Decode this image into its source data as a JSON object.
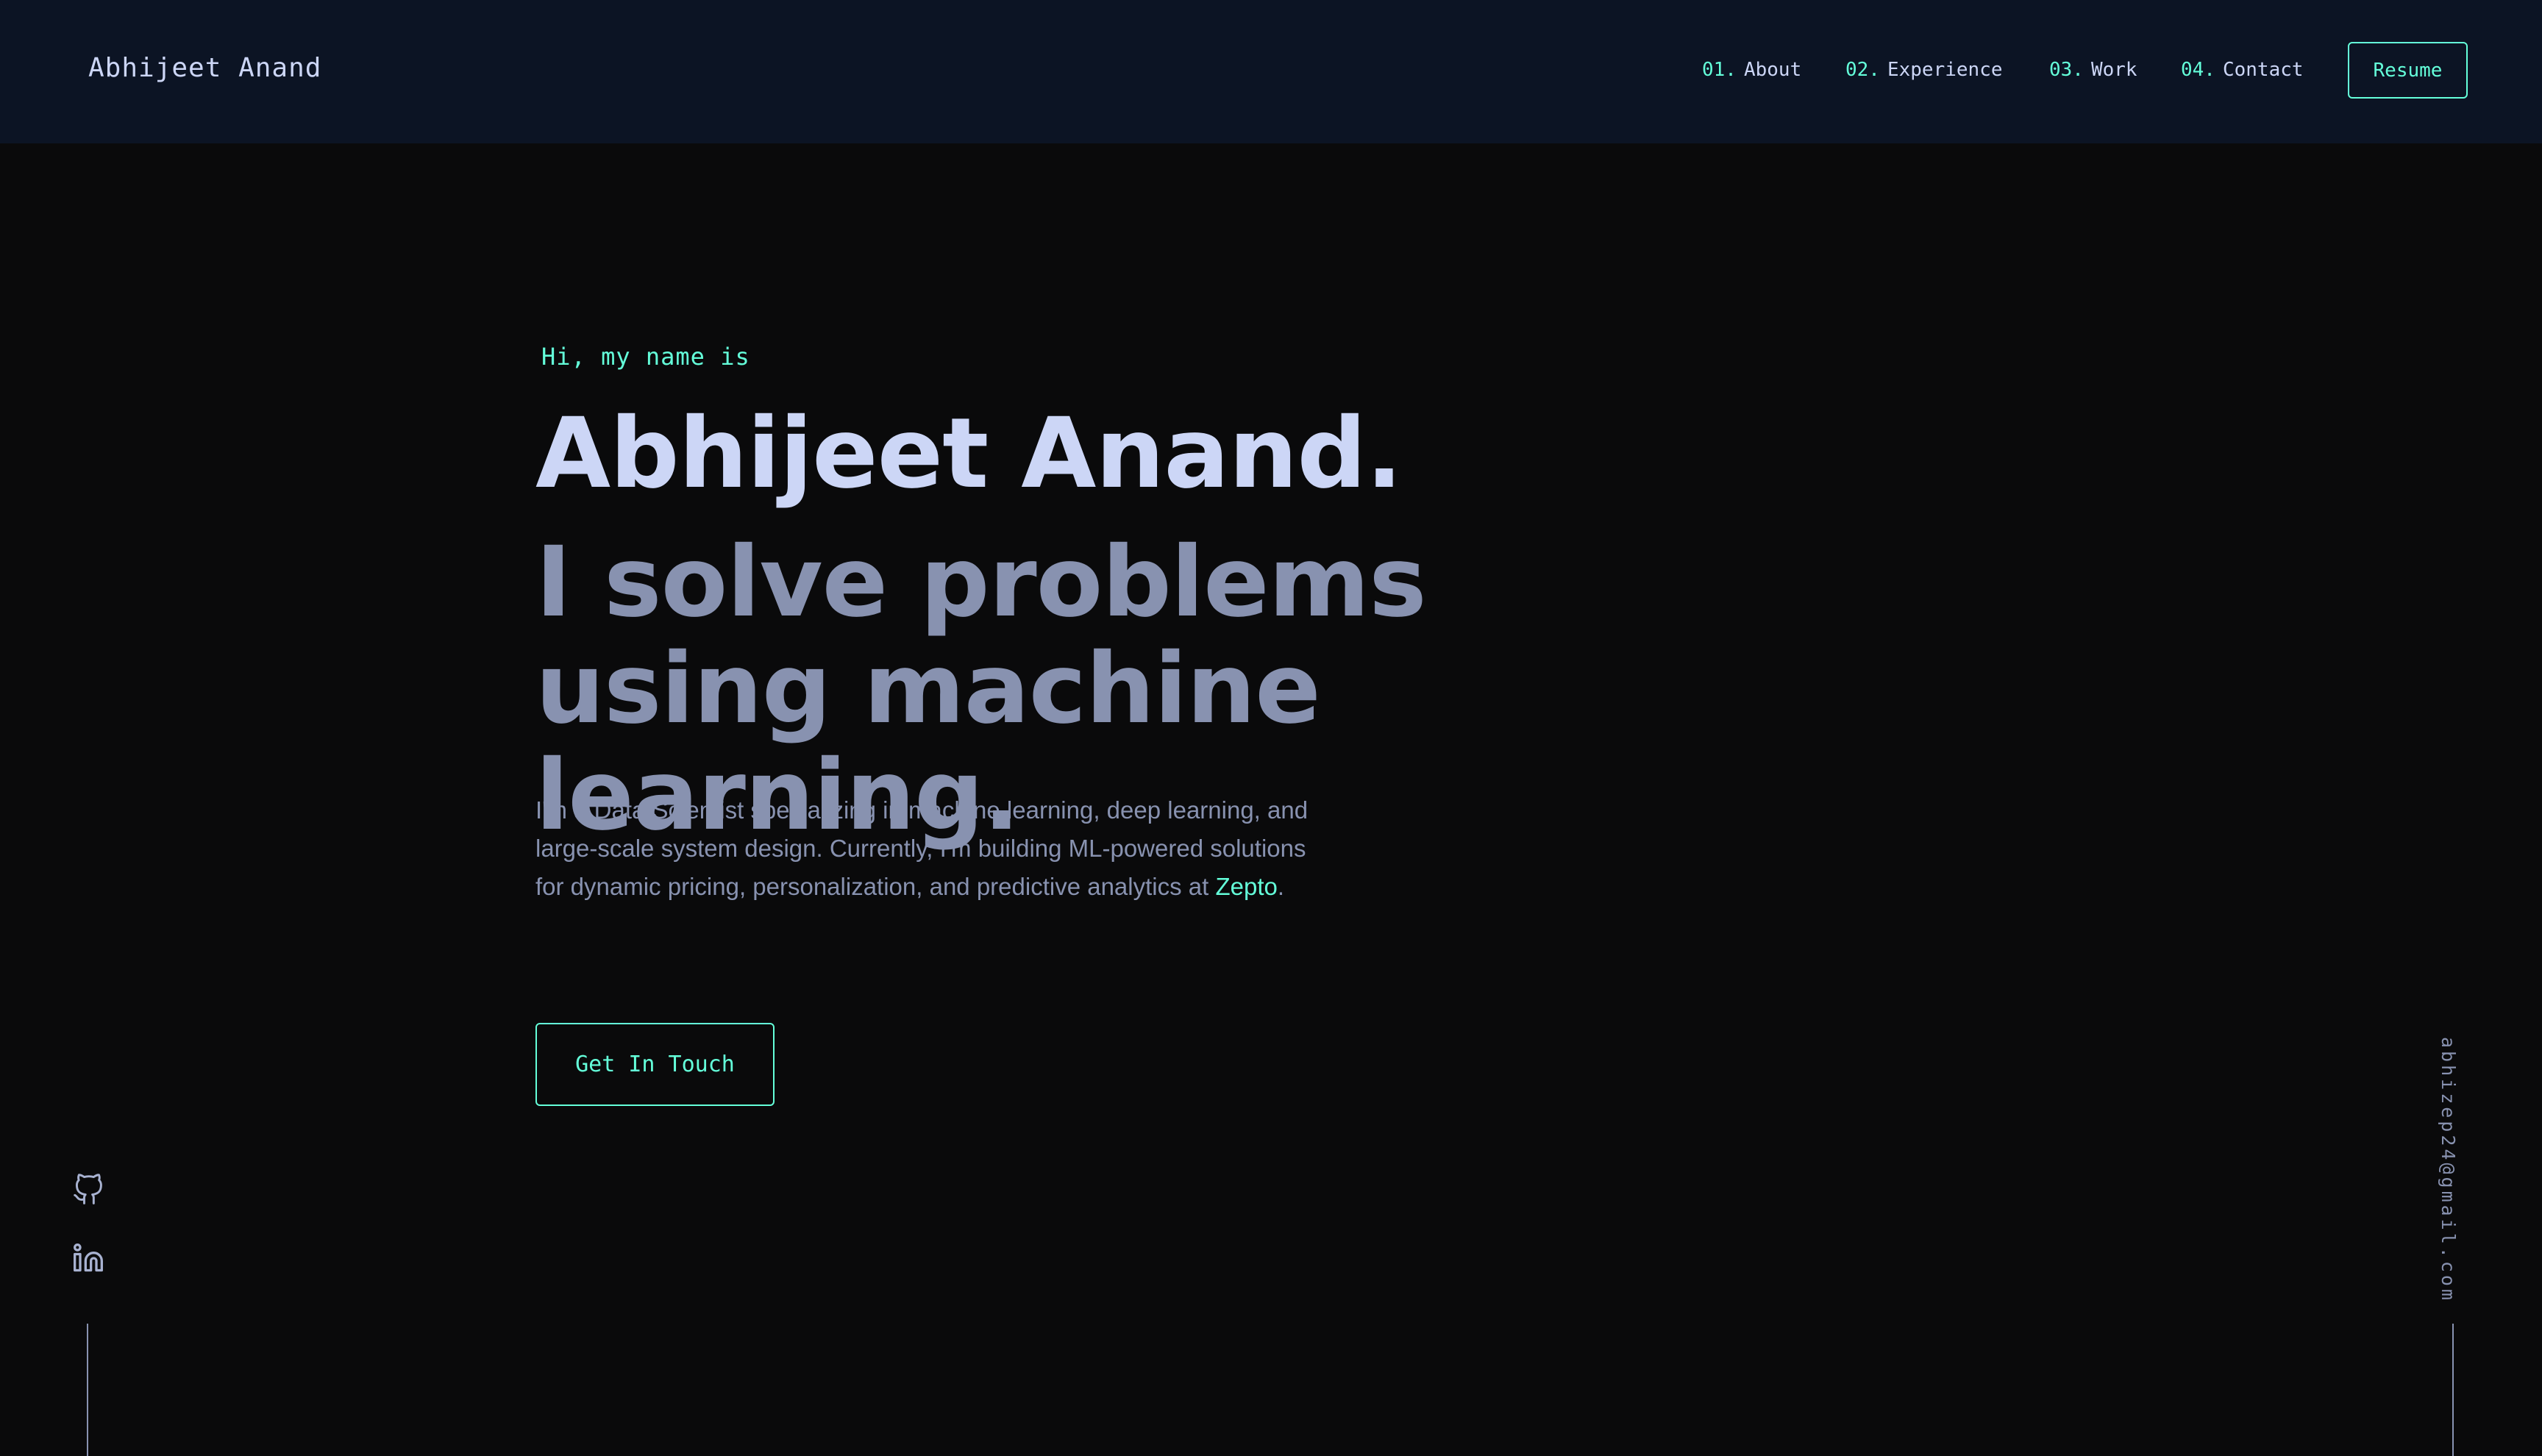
{
  "header": {
    "brand": "Abhijeet Anand",
    "nav": [
      {
        "num": "01.",
        "label": "About"
      },
      {
        "num": "02.",
        "label": "Experience"
      },
      {
        "num": "03.",
        "label": "Work"
      },
      {
        "num": "04.",
        "label": "Contact"
      }
    ],
    "resume_label": "Resume"
  },
  "hero": {
    "greeting": "Hi, my name is",
    "name": "Abhijeet Anand.",
    "tagline": "I solve problems using machine learning.",
    "bio_prefix": "I'm a Data Scientist specializing in machine learning, deep learning, and large-scale system design. Currently, I'm building ML-powered solutions for dynamic pricing, personalization, and predictive analytics at ",
    "bio_company": "Zepto",
    "bio_suffix": ".",
    "cta_label": "Get In Touch"
  },
  "sidebar_left": {
    "icons": [
      "github-icon",
      "linkedin-icon"
    ]
  },
  "sidebar_right": {
    "email": "abhizep24@gmail.com"
  },
  "colors": {
    "background": "#0a0a0b",
    "header_bg": "#0c1424",
    "accent": "#64ffda",
    "heading": "#ccd6f6",
    "muted": "#8892b0"
  }
}
